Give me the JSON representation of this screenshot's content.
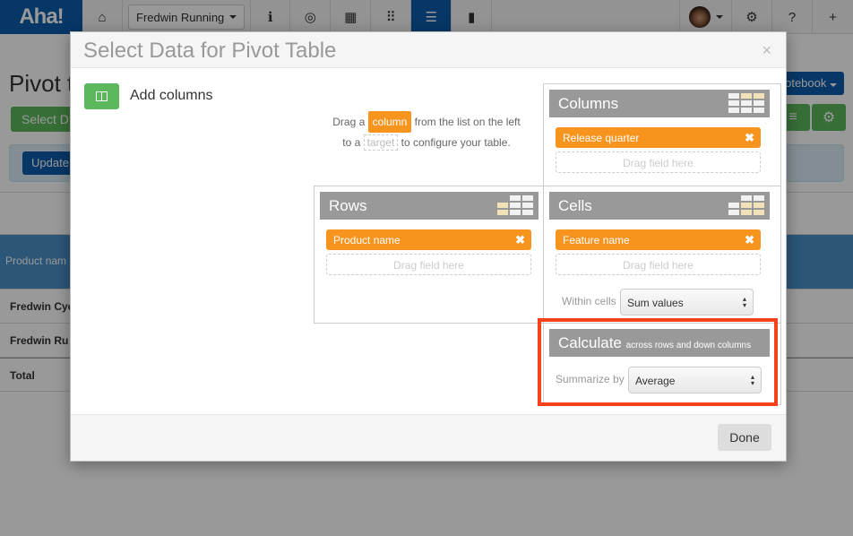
{
  "topbar": {
    "logo": "Aha!",
    "product_selector": "Fredwin Running",
    "icons": [
      "home-icon",
      "info-icon",
      "target-icon",
      "calendar-icon",
      "grid-icon",
      "reports-icon",
      "notebook-icon"
    ],
    "right_icons": [
      "avatar",
      "gear-icon",
      "help-icon",
      "plus-icon"
    ]
  },
  "page": {
    "title": "Pivot ta",
    "select_data_label": "Select D",
    "update_label": "Update",
    "notebook_label": "otebook",
    "table": {
      "header": "Product nam",
      "rows": [
        "Fredwin Cyc",
        "Fredwin Ru"
      ],
      "total": "Total"
    }
  },
  "modal": {
    "title": "Select Data for Pivot Table",
    "close": "×",
    "add_columns_label": "Add columns",
    "help": {
      "line1_pre": "Drag a",
      "chip_column": "column",
      "line1_post": "from the list on the left",
      "line2_pre": "to a",
      "chip_target": "target",
      "line2_post": "to configure your table."
    },
    "columns": {
      "title": "Columns",
      "fields": [
        "Release quarter"
      ],
      "dropzone": "Drag field here"
    },
    "rows": {
      "title": "Rows",
      "fields": [
        "Product name"
      ],
      "dropzone": "Drag field here"
    },
    "cells": {
      "title": "Cells",
      "fields": [
        "Feature name"
      ],
      "dropzone": "Drag field here",
      "within_label": "Within cells",
      "within_value": "Sum values"
    },
    "calculate": {
      "title": "Calculate",
      "subtitle": "across rows and down columns",
      "summarize_label": "Summarize by",
      "summarize_value": "Average"
    },
    "done_label": "Done",
    "remove_glyph": "✖",
    "colors": {
      "accent_orange": "#f7941d",
      "highlight": "#f5421b",
      "brand_blue": "#0b5cab",
      "green": "#5cb85c"
    }
  }
}
